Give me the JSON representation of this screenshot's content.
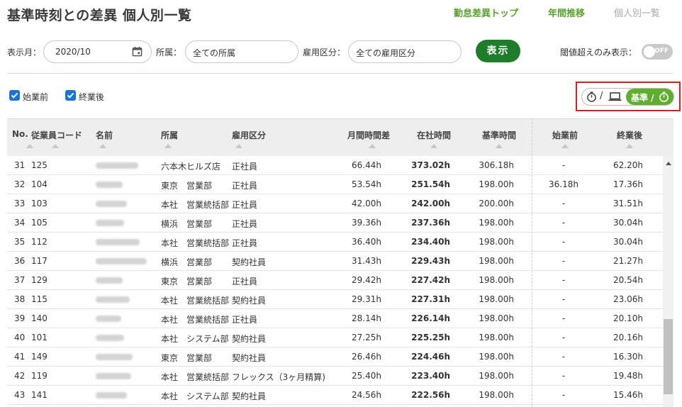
{
  "page_title": "基準時刻との差異 個人別一覧",
  "nav": {
    "item1": "勤怠差異トップ",
    "item2": "年間推移",
    "item3": "個人別一覧"
  },
  "filters": {
    "month_label": "表示月：",
    "month_value": "2020/10",
    "dept_label": "所属：",
    "dept_value": "全ての所属",
    "emp_type_label": "雇用区分：",
    "emp_type_value": "全ての雇用区分",
    "show_button": "表示",
    "threshold_label": "閾値超えのみ表示：",
    "threshold_toggle": "OFF"
  },
  "checkboxes": {
    "start": "始業前",
    "end": "終業後"
  },
  "mode_toggle": {
    "left_sep": "/",
    "right_label": "基準 /"
  },
  "table": {
    "headers": [
      "No.",
      "従業員コード",
      "名前",
      "所属",
      "雇用区分",
      "月間時間差",
      "在社時間",
      "基準時間",
      "始業前",
      "終業後"
    ],
    "rows": [
      [
        "31",
        "125",
        "六本木ヒルズ店",
        "正社員",
        "66.44h",
        "373.02h",
        "306.18h",
        "-",
        "62.20h"
      ],
      [
        "32",
        "104",
        "東京　営業部",
        "正社員",
        "53.54h",
        "251.54h",
        "198.00h",
        "36.18h",
        "17.36h"
      ],
      [
        "33",
        "103",
        "本社　営業統括部",
        "正社員",
        "42.00h",
        "242.00h",
        "200.00h",
        "-",
        "31.51h"
      ],
      [
        "34",
        "105",
        "横浜　営業部",
        "正社員",
        "39.36h",
        "237.36h",
        "198.00h",
        "-",
        "30.04h"
      ],
      [
        "35",
        "112",
        "本社　営業統括部",
        "正社員",
        "36.40h",
        "234.40h",
        "198.00h",
        "-",
        "30.04h"
      ],
      [
        "36",
        "117",
        "横浜　営業部",
        "契約社員",
        "31.43h",
        "229.43h",
        "198.00h",
        "-",
        "21.27h"
      ],
      [
        "37",
        "129",
        "東京　営業部",
        "正社員",
        "29.42h",
        "227.42h",
        "198.00h",
        "-",
        "20.54h"
      ],
      [
        "38",
        "115",
        "本社　営業統括部",
        "契約社員",
        "29.31h",
        "227.31h",
        "198.00h",
        "-",
        "23.06h"
      ],
      [
        "39",
        "140",
        "本社　営業統括部",
        "正社員",
        "28.14h",
        "226.14h",
        "198.00h",
        "-",
        "20.10h"
      ],
      [
        "40",
        "101",
        "本社　システム部",
        "契約社員",
        "27.25h",
        "225.25h",
        "198.00h",
        "-",
        "20.16h"
      ],
      [
        "41",
        "149",
        "東京　営業部",
        "契約社員",
        "26.46h",
        "224.46h",
        "198.00h",
        "-",
        "16.30h"
      ],
      [
        "42",
        "119",
        "本社　営業統括部",
        "フレックス（3ヶ月精算)",
        "25.40h",
        "223.40h",
        "198.00h",
        "-",
        "19.48h"
      ],
      [
        "43",
        "141",
        "本社　システム部",
        "契約社員",
        "24.56h",
        "222.56h",
        "198.00h",
        "-",
        "15.46h"
      ]
    ]
  },
  "colors": {
    "accent_green": "#5aa22b",
    "button_green": "#1e7d2b",
    "checkbox_blue": "#1a73d9",
    "highlight_red": "#e01b1b"
  },
  "icons": [
    "calendar-icon",
    "stopwatch-icon",
    "laptop-icon",
    "check-icon",
    "sort-icon"
  ]
}
